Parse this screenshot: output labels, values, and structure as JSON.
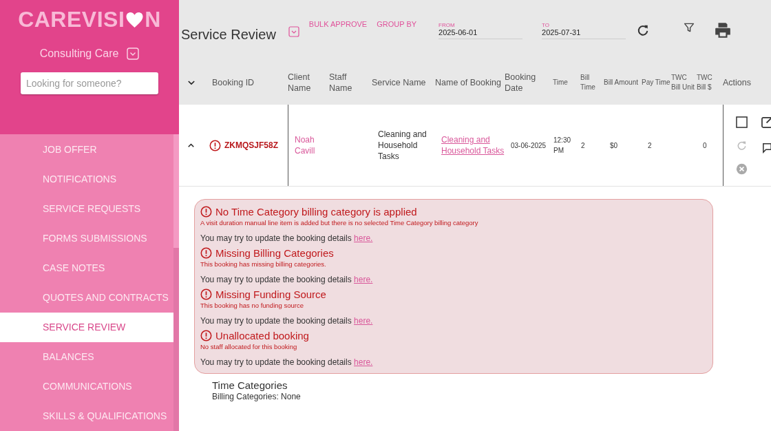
{
  "logo": {
    "text_before": "CAREVISI",
    "text_after": "N"
  },
  "organization": {
    "name": "Consulting Care"
  },
  "search": {
    "placeholder": "Looking for someone?"
  },
  "nav": [
    {
      "label": "JOB OFFER",
      "selected": false
    },
    {
      "label": "NOTIFICATIONS",
      "selected": false
    },
    {
      "label": "SERVICE REQUESTS",
      "selected": false
    },
    {
      "label": "FORMS SUBMISSIONS",
      "selected": false
    },
    {
      "label": "CASE NOTES",
      "selected": false
    },
    {
      "label": "QUOTES AND CONTRACTS",
      "selected": false
    },
    {
      "label": "SERVICE REVIEW",
      "selected": true
    },
    {
      "label": "BALANCES",
      "selected": false
    },
    {
      "label": "COMMUNICATIONS",
      "selected": false
    },
    {
      "label": "SKILLS & QUALIFICATIONS",
      "selected": false
    }
  ],
  "page_title": "Service Review",
  "toolbar_links": [
    "BULK APPROVE",
    "GROUP BY"
  ],
  "date_from": {
    "label": "FROM",
    "value": "2025-06-01"
  },
  "date_to": {
    "label": "TO",
    "value": "2025-07-31"
  },
  "table": {
    "columns": [
      "Booking ID",
      "Client Name",
      "Staff Name",
      "Service Name",
      "Name of Booking",
      "Booking Date",
      "Time",
      "Bill Time",
      "Bill Amount",
      "Pay Time",
      "TWC Bill Unit",
      "TWC Bill $",
      "Actions"
    ],
    "rows": [
      {
        "expanded": true,
        "warning": true,
        "checked": false,
        "booking_id": "ZKMQSJF58Z",
        "client_name": "Noah Cavill",
        "service_name": "Cleaning and Household Tasks",
        "name_of_booking": "Cleaning and Household Tasks",
        "booking_date": "03-06-2025",
        "time": "12:30 PM",
        "bill_time": "2",
        "bill_amount": "$0",
        "pay_time": "2",
        "twc_bill": "0"
      }
    ]
  },
  "issues": [
    {
      "title": "No Time Category billing category is applied",
      "description": "A visit duration manual line item is added but there is no selected Time Category billing category",
      "help_text": "You may try to update the booking details",
      "link": "here."
    },
    {
      "title": "Missing Billing Categories",
      "description": "This booking has missing billing categories.",
      "help_text": "You may try to update the booking details",
      "link": "here."
    },
    {
      "title": "Missing Funding Source",
      "description": "This booking has no funding source",
      "help_text": "You may try to update the booking details",
      "link": "here."
    },
    {
      "title": "Unallocated booking",
      "description": "No staff allocated for this booking",
      "help_text": "You may try to update the booking details",
      "link": "here."
    }
  ],
  "time_categories": {
    "title": "Time Categories",
    "billing": "Billing Categories: None"
  }
}
